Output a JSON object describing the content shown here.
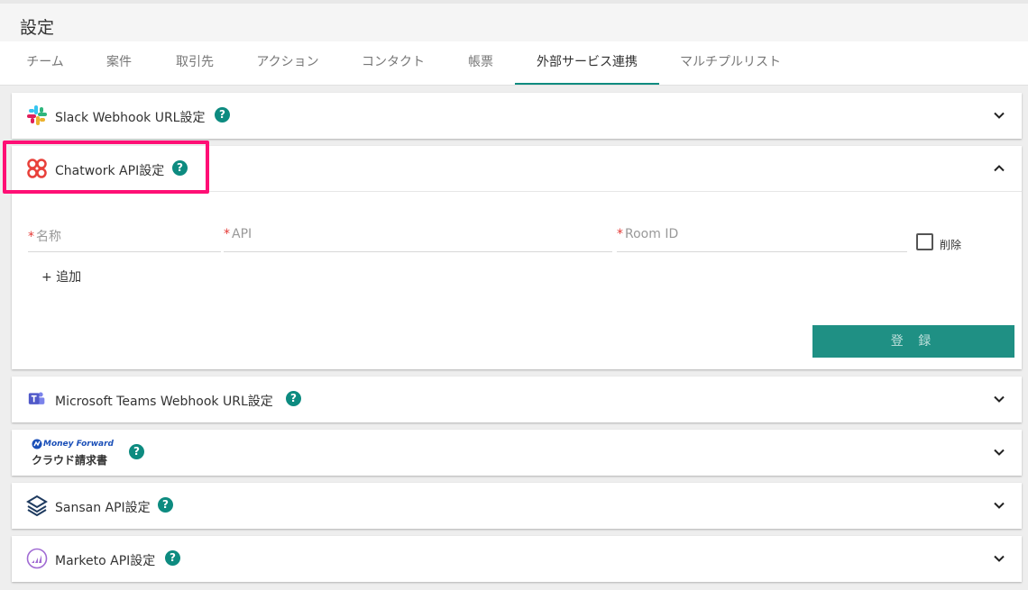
{
  "header": {
    "title": "設定"
  },
  "tabs": [
    {
      "label": "チーム"
    },
    {
      "label": "案件"
    },
    {
      "label": "取引先"
    },
    {
      "label": "アクション"
    },
    {
      "label": "コンタクト"
    },
    {
      "label": "帳票"
    },
    {
      "label": "外部サービス連携",
      "active": true
    },
    {
      "label": "マルチプルリスト"
    }
  ],
  "panels": {
    "slack": {
      "label": "Slack Webhook URL設定",
      "icon": "slack-logo-icon",
      "expanded": false
    },
    "chatwork": {
      "label": "Chatwork API設定",
      "icon": "chatwork-logo-icon",
      "expanded": true,
      "fields": {
        "name": {
          "required": "*",
          "placeholder": "名称"
        },
        "api": {
          "required": "*",
          "placeholder": "API"
        },
        "room_id": {
          "required": "*",
          "placeholder": "Room ID"
        }
      },
      "delete_label": "削除",
      "add_label": "+ 追加",
      "submit_label": "登 録"
    },
    "teams": {
      "label": "Microsoft Teams Webhook URL設定",
      "icon": "teams-logo-icon",
      "expanded": false
    },
    "moneyforward": {
      "logo_top": "Money Forward",
      "logo_bottom": "クラウド請求書",
      "icon": "moneyforward-logo-icon",
      "expanded": false
    },
    "sansan": {
      "label": "Sansan API設定",
      "icon": "sansan-logo-icon",
      "expanded": false
    },
    "marketo": {
      "label": "Marketo API設定",
      "icon": "marketo-logo-icon",
      "expanded": false
    }
  },
  "help_glyph": "?",
  "colors": {
    "accent": "#0d8b80",
    "highlight": "#ff0f75",
    "required": "#e53935"
  }
}
